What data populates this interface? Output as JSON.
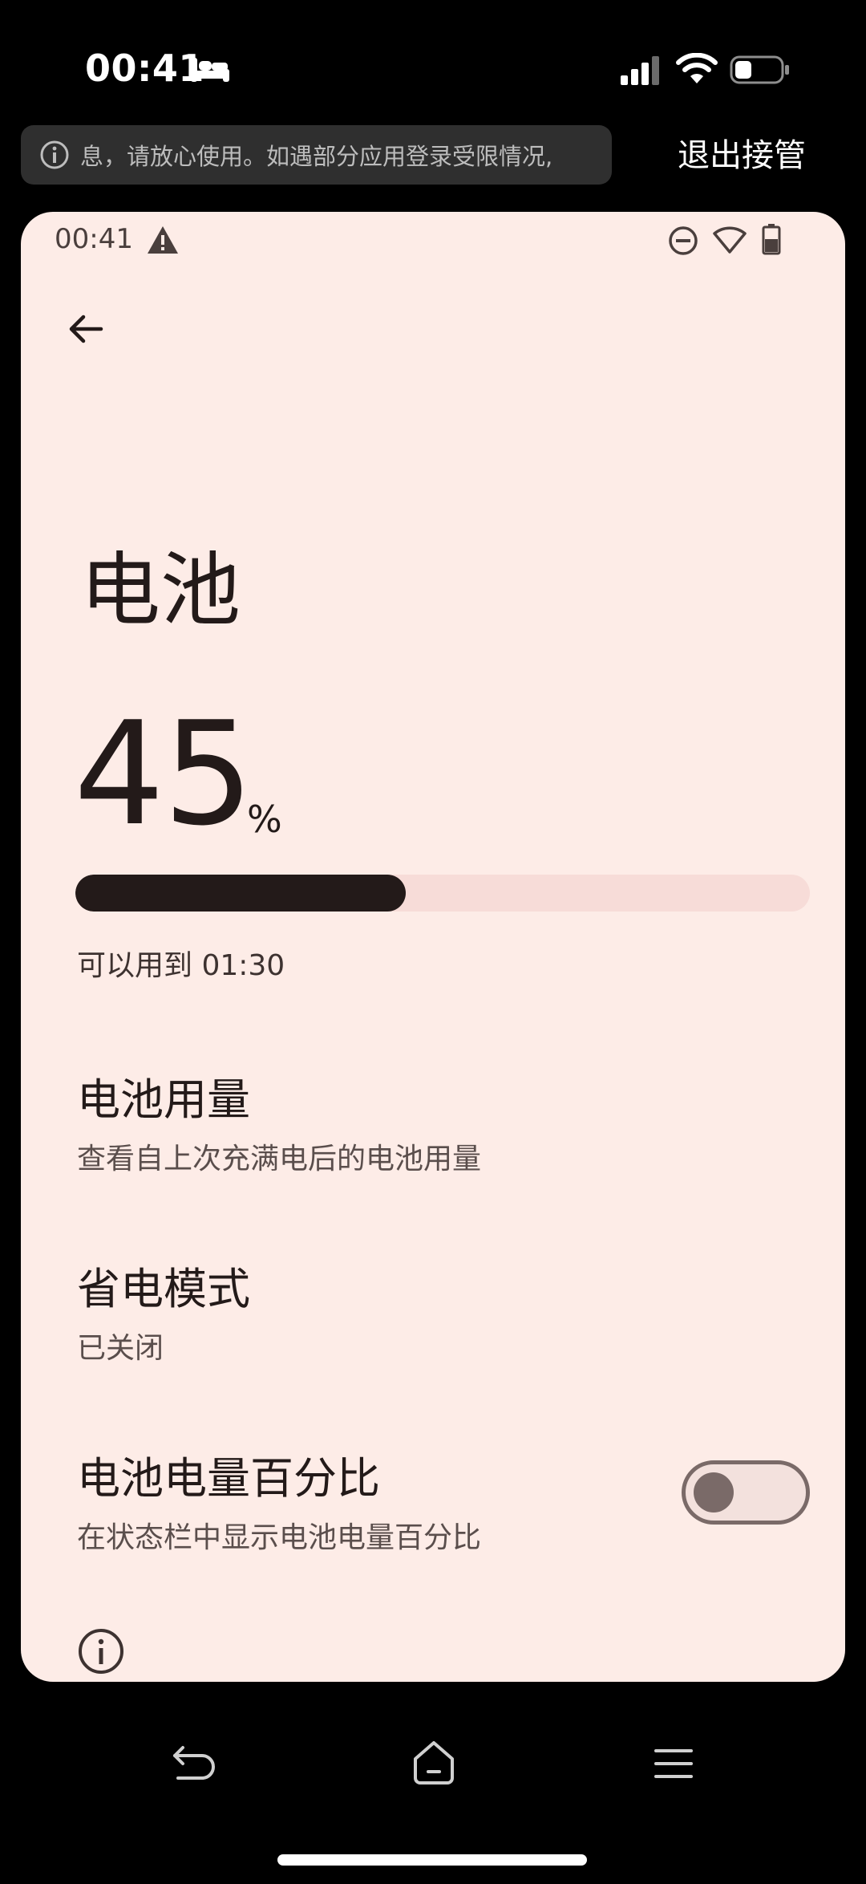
{
  "ios_status": {
    "time": "00:41",
    "icons": [
      "bed-icon",
      "cellular-signal-icon",
      "wifi-icon",
      "battery-icon"
    ]
  },
  "remote_banner": {
    "notice_text": "息，请放心使用。如遇部分应用登录受限情况,",
    "exit_label": "退出接管"
  },
  "android_status": {
    "time": "00:41",
    "icons": [
      "warning-icon",
      "do-not-disturb-icon",
      "wifi-icon",
      "battery-icon"
    ]
  },
  "battery_page": {
    "title": "电池",
    "level_value": "45",
    "level_unit": "%",
    "level_fraction": 0.45,
    "remaining_text": "可以用到 01:30",
    "items": [
      {
        "title": "电池用量",
        "summary": "查看自上次充满电后的电池用量"
      },
      {
        "title": "省电模式",
        "summary": "已关闭"
      },
      {
        "title": "电池电量百分比",
        "summary": "在状态栏中显示电池电量百分比",
        "toggle_on": false
      }
    ]
  },
  "nav_bar": {
    "icons": [
      "back-icon",
      "home-icon",
      "menu-icon"
    ]
  },
  "colors": {
    "screen_background": "#fdece7",
    "primary_text": "#231a19",
    "level_track": "#f7dcd8",
    "toggle_outline": "#7a6a68"
  }
}
